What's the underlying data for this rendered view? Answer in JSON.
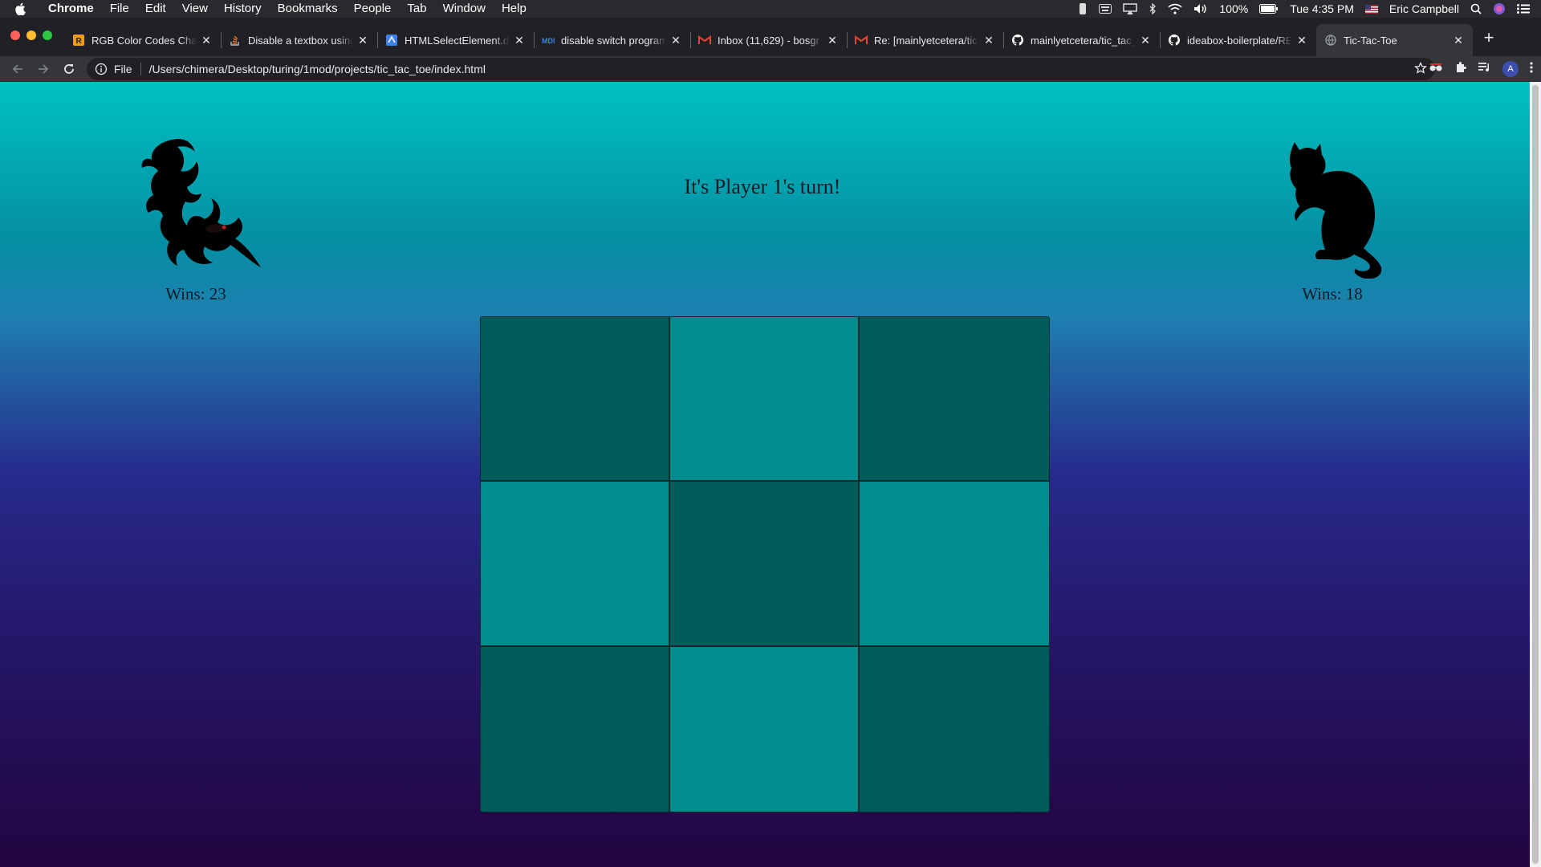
{
  "menubar": {
    "app": "Chrome",
    "items": [
      "File",
      "Edit",
      "View",
      "History",
      "Bookmarks",
      "People",
      "Tab",
      "Window",
      "Help"
    ],
    "battery": "100%",
    "clock": "Tue 4:35 PM",
    "user": "Eric Campbell"
  },
  "tabs": [
    {
      "title": "RGB Color Codes Chart",
      "favicon": "r-square-icon",
      "favicon_color": "#f29a1f",
      "glyph": "R"
    },
    {
      "title": "Disable a textbox using",
      "favicon": "stackoverflow-icon",
      "favicon_color": "#f48024",
      "glyph": ""
    },
    {
      "title": "HTMLSelectElement.di",
      "favicon": "mdn-icon",
      "favicon_color": "#3c7ff0",
      "glyph": ""
    },
    {
      "title": "disable switch program",
      "favicon": "mdn-icon",
      "favicon_color": "#3c7ff0",
      "glyph": ""
    },
    {
      "title": "Inbox (11,629) - bosgr",
      "favicon": "gmail-icon",
      "favicon_color": "#ea4335",
      "glyph": "M"
    },
    {
      "title": "Re: [mainlyetcetera/tic",
      "favicon": "gmail-icon",
      "favicon_color": "#ea4335",
      "glyph": "M"
    },
    {
      "title": "mainlyetcetera/tic_tac_",
      "favicon": "github-icon",
      "favicon_color": "#ffffff",
      "glyph": ""
    },
    {
      "title": "ideabox-boilerplate/RE",
      "favicon": "github-icon",
      "favicon_color": "#ffffff",
      "glyph": ""
    },
    {
      "title": "Tic-Tac-Toe",
      "favicon": "globe-icon",
      "favicon_color": "#9aa0a6",
      "glyph": "",
      "active": true
    }
  ],
  "omnibox": {
    "scheme": "File",
    "url": "/Users/chimera/Desktop/turing/1mod/projects/tic_tac_toe/index.html"
  },
  "toolbar": {
    "avatar_letter": "A"
  },
  "game": {
    "turn_message": "It's Player 1's turn!",
    "player1": {
      "token": "dragon-icon",
      "wins_label": "Wins: 23"
    },
    "player2": {
      "token": "cat-icon",
      "wins_label": "Wins: 18"
    },
    "board": [
      "dark",
      "light",
      "dark",
      "light",
      "dark",
      "light",
      "dark",
      "light",
      "dark"
    ],
    "colors": {
      "dark_cell": "#025c5c",
      "light_cell": "#018d8d",
      "gradient_top": "#00c2c3",
      "gradient_bottom": "#220541"
    }
  }
}
